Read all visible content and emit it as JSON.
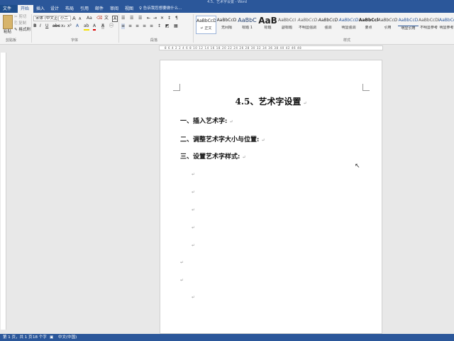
{
  "app": {
    "title": "4.5、艺术字设置 - Word"
  },
  "tabs": [
    "文件",
    "开始",
    "插入",
    "设计",
    "布局",
    "引用",
    "邮件",
    "审阅",
    "视图"
  ],
  "tell_me": "告诉我您想要做什么...",
  "clipboard": {
    "cut": "剪切",
    "copy": "复制",
    "paste": "粘贴",
    "format_painter": "格式刷",
    "group": "剪贴板"
  },
  "font": {
    "name": "宋体 (中文正)",
    "size": "小二",
    "grow": "A",
    "shrink": "A",
    "clear": "Aa",
    "group": "字体"
  },
  "paragraph": {
    "group": "段落"
  },
  "styles": {
    "group": "样式",
    "items": [
      {
        "preview": "AaBbCcD",
        "name": "↵ 正文"
      },
      {
        "preview": "AaBbCcD",
        "name": "无间隔"
      },
      {
        "preview": "AaBbC",
        "name": "标题 1"
      },
      {
        "preview": "AaB",
        "name": "标题"
      },
      {
        "preview": "AaBbCcI",
        "name": "副标题"
      },
      {
        "preview": "AaBbCcD",
        "name": "不明显强调"
      },
      {
        "preview": "AaBbCcD",
        "name": "强调"
      },
      {
        "preview": "AaBbCcD",
        "name": "明显强调"
      },
      {
        "preview": "AaBbCcl",
        "name": "要点"
      },
      {
        "preview": "AaBbCcD",
        "name": "引用"
      },
      {
        "preview": "AaBbCcD",
        "name": "明显引用"
      },
      {
        "preview": "AaBbCcDi",
        "name": "不明显参考"
      },
      {
        "preview": "AaBbCcDi",
        "name": "明显参考"
      }
    ]
  },
  "ruler": {
    "numbers": "8  6  4  2     2  4  6  8  10  12  14  16  18  20  22  24  26  28  30  32  34  36  38  40  42     46  48"
  },
  "document": {
    "title": "4.5、艺术字设置",
    "headings": [
      "一、插入艺术字:",
      "二、调整艺术字大小与位置:",
      "三、设置艺术字样式:"
    ],
    "paragraph_mark": "↵"
  },
  "status": {
    "page": "第 1 页，共 1 页",
    "words": "18 个字",
    "language": "中文(中国)"
  },
  "colors": {
    "accent": "#2b579a",
    "ribbon": "#f3f3f3",
    "canvas": "#e8e8e8"
  }
}
